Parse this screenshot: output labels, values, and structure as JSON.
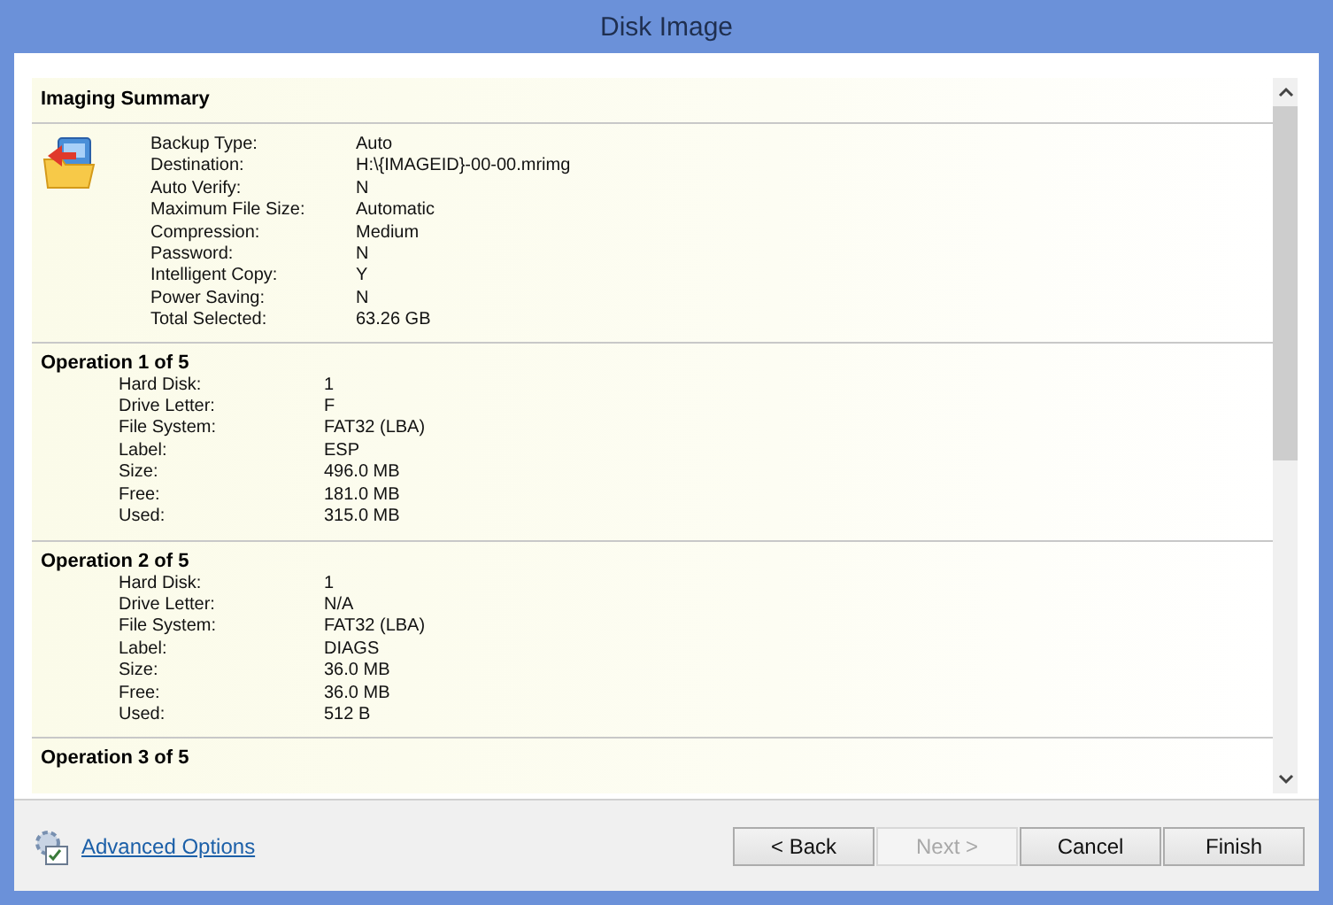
{
  "window": {
    "title": "Disk Image"
  },
  "summary": {
    "title": "Imaging Summary",
    "rows": [
      {
        "label": "Backup Type:",
        "value": "Auto"
      },
      {
        "label": "Destination:",
        "value": "H:\\{IMAGEID}-00-00.mrimg"
      },
      {
        "label": "Auto Verify:",
        "value": "N"
      },
      {
        "label": "Maximum File Size:",
        "value": "Automatic"
      },
      {
        "label": "Compression:",
        "value": "Medium"
      },
      {
        "label": "Password:",
        "value": "N"
      },
      {
        "label": "Intelligent Copy:",
        "value": "Y"
      },
      {
        "label": "Power Saving:",
        "value": "N"
      },
      {
        "label": "Total Selected:",
        "value": "63.26 GB"
      }
    ]
  },
  "operations": [
    {
      "title": "Operation 1 of 5",
      "rows": [
        {
          "label": "Hard Disk:",
          "value": "1"
        },
        {
          "label": "Drive Letter:",
          "value": "F"
        },
        {
          "label": "File System:",
          "value": "FAT32 (LBA)"
        },
        {
          "label": "Label:",
          "value": "ESP"
        },
        {
          "label": "Size:",
          "value": "496.0 MB"
        },
        {
          "label": "Free:",
          "value": "181.0 MB"
        },
        {
          "label": "Used:",
          "value": "315.0 MB"
        }
      ]
    },
    {
      "title": "Operation 2 of 5",
      "rows": [
        {
          "label": "Hard Disk:",
          "value": "1"
        },
        {
          "label": "Drive Letter:",
          "value": "N/A"
        },
        {
          "label": "File System:",
          "value": "FAT32 (LBA)"
        },
        {
          "label": "Label:",
          "value": "DIAGS"
        },
        {
          "label": "Size:",
          "value": "36.0 MB"
        },
        {
          "label": "Free:",
          "value": "36.0 MB"
        },
        {
          "label": "Used:",
          "value": "512 B"
        }
      ]
    },
    {
      "title": "Operation 3 of 5"
    }
  ],
  "footer": {
    "link": "Advanced Options",
    "buttons": [
      {
        "label": "< Back",
        "disabled": false
      },
      {
        "label": "Next >",
        "disabled": true
      },
      {
        "label": "Cancel",
        "disabled": false
      },
      {
        "label": "Finish",
        "disabled": false
      }
    ]
  }
}
